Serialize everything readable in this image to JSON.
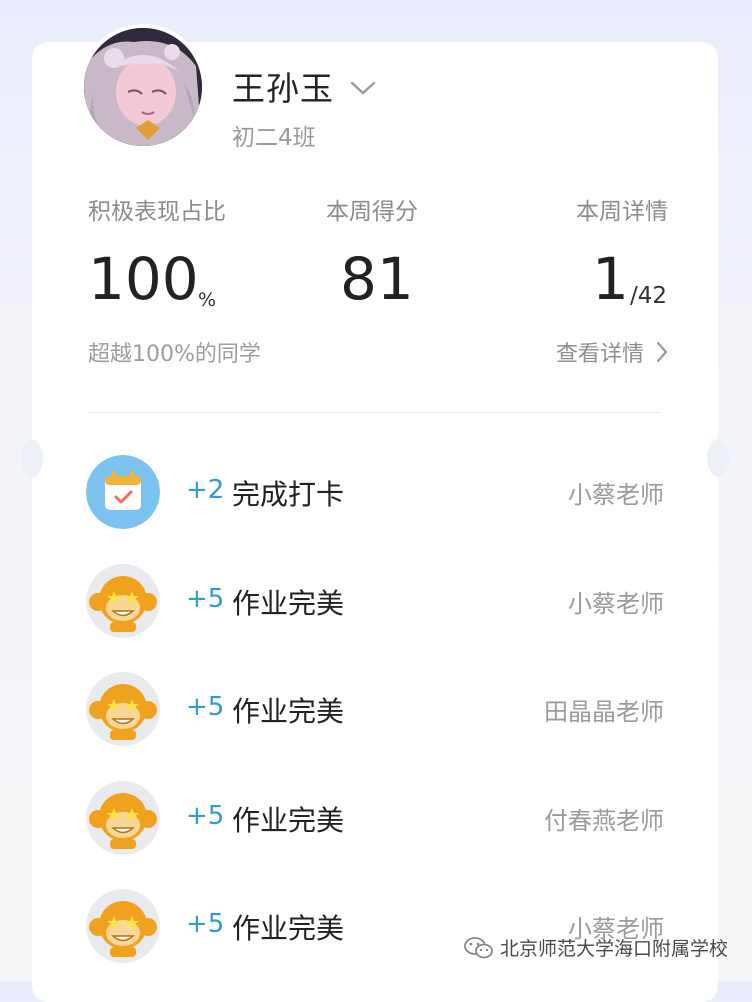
{
  "profile": {
    "name": "王孙玉",
    "class": "初二4班"
  },
  "stats": {
    "active_ratio": {
      "label": "积极表现占比",
      "value": "100",
      "unit": "%",
      "sub": "超越100%的同学"
    },
    "weekly_score": {
      "label": "本周得分",
      "value": "81"
    },
    "weekly_detail": {
      "label": "本周详情",
      "rank": "1",
      "total": "/42",
      "link": "查看详情"
    }
  },
  "records": [
    {
      "icon": "calendar-check-icon",
      "points": "+2",
      "reason": "完成打卡",
      "teacher": "小蔡老师"
    },
    {
      "icon": "monkey-star-eyes-icon",
      "points": "+5",
      "reason": "作业完美",
      "teacher": "小蔡老师"
    },
    {
      "icon": "monkey-star-eyes-icon",
      "points": "+5",
      "reason": "作业完美",
      "teacher": "田晶晶老师"
    },
    {
      "icon": "monkey-star-eyes-icon",
      "points": "+5",
      "reason": "作业完美",
      "teacher": "付春燕老师"
    },
    {
      "icon": "monkey-star-eyes-icon",
      "points": "+5",
      "reason": "作业完美",
      "teacher": "小蔡老师"
    }
  ],
  "watermark": {
    "text": "北京师范大学海口附属学校"
  },
  "colors": {
    "points": "#2f9bd6",
    "monkey": "#f0a21e",
    "calendar": "#5fb6ee"
  }
}
